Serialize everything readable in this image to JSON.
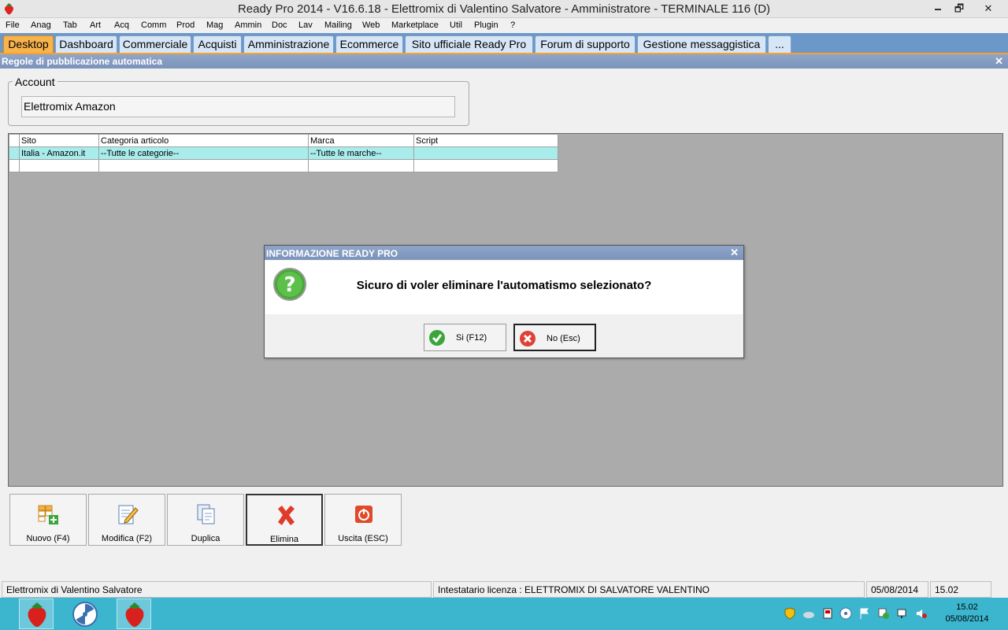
{
  "window": {
    "title": "Ready Pro 2014 - V16.6.18 - Elettromix di Valentino Salvatore - Amministratore - TERMINALE 116 (D)",
    "minimize": "🗕",
    "maximize": "🗗",
    "close": "✕"
  },
  "menu": [
    "File",
    "Anag",
    "Tab",
    "Art",
    "Acq",
    "Comm",
    "Prod",
    "Mag",
    "Ammin",
    "Doc",
    "Lav",
    "Mailing",
    "Web",
    "Marketplace",
    "Util",
    "Plugin",
    "?"
  ],
  "tabs": [
    "Desktop",
    "Dashboard",
    "Commerciale",
    "Acquisti",
    "Amministrazione",
    "Ecommerce",
    "Sito ufficiale Ready Pro",
    "Forum di supporto",
    "Gestione messaggistica",
    "..."
  ],
  "panel": {
    "title": "Regole di pubblicazione automatica",
    "close": "✕",
    "account_legend": "Account",
    "account_value": "Elettromix Amazon"
  },
  "grid": {
    "columns": [
      "Sito",
      "Categoria articolo",
      "Marca",
      "Script"
    ],
    "rows": [
      [
        "Italia - Amazon.it",
        "--Tutte le categorie--",
        "--Tutte le marche--",
        ""
      ],
      [
        "",
        "",
        "",
        ""
      ]
    ]
  },
  "dialog": {
    "title": "INFORMAZIONE READY PRO",
    "close": "✕",
    "message": "Sicuro di voler eliminare l'automatismo selezionato?",
    "yes_label": "Si (F12)",
    "no_label": "No (Esc)"
  },
  "toolbar": {
    "new_label": "Nuovo (F4)",
    "edit_label": "Modifica (F2)",
    "duplicate_label": "Duplica",
    "delete_label": "Elimina",
    "exit_label": "Uscita (ESC)"
  },
  "statusbar": {
    "company": "Elettromix di Valentino Salvatore",
    "license": "Intestatario licenza : ELETTROMIX DI SALVATORE VALENTINO",
    "date": "05/08/2014",
    "time": "15.02"
  },
  "taskbar": {
    "clock_time": "15.02",
    "clock_date": "05/08/2014"
  },
  "colors": {
    "tab_active": "#f7b34c",
    "tabstrip": "#6b98c9",
    "caption": "#7b93bb",
    "grid_background": "#ababab",
    "selected_row": "#a8ecec",
    "taskbar": "#3cb6cf"
  }
}
